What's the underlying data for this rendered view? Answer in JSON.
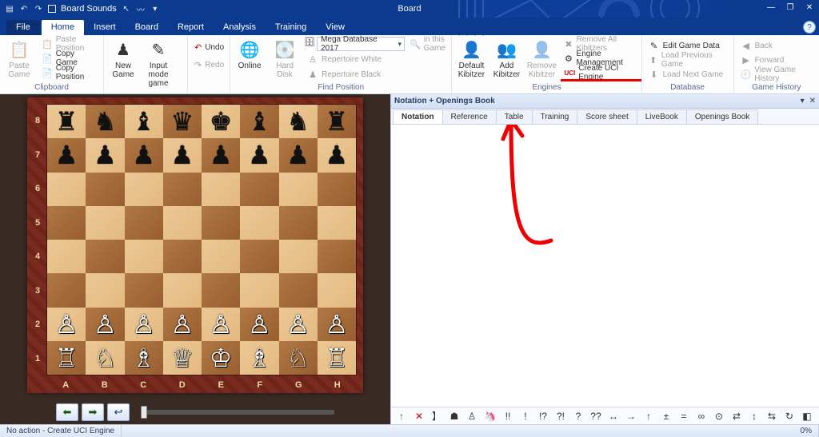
{
  "app": {
    "title": "Board",
    "sounds_label": "Board Sounds"
  },
  "window_buttons": {
    "minimize": "—",
    "maximize": "❐",
    "close": "✕"
  },
  "tabs": {
    "file": "File",
    "items": [
      "Home",
      "Insert",
      "Board",
      "Report",
      "Analysis",
      "Training",
      "View"
    ],
    "active_index": 0
  },
  "ribbon": {
    "clipboard": {
      "title": "Clipboard",
      "paste_game": "Paste\nGame",
      "paste_position": "Paste Position",
      "copy_game": "Copy Game",
      "copy_position": "Copy Position"
    },
    "gamemode": {
      "new_game": "New\nGame",
      "input_mode": "Input\nmode\ngame",
      "undo": "Undo",
      "redo": "Redo"
    },
    "find": {
      "title": "Find Position",
      "online": "Online",
      "hard_disk": "Hard\nDisk",
      "database_label": "Mega Database 2017",
      "in_this_game": "in this Game",
      "rep_white": "Repertoire White",
      "rep_black": "Repertoire Black"
    },
    "engines": {
      "title": "Engines",
      "default_kibitzer": "Default\nKibitzer",
      "add_kibitzer": "Add\nKibitzer",
      "remove_kibitzer": "Remove\nKibitzer",
      "remove_all": "Remove All Kibitzers",
      "engine_mgmt": "Engine Management",
      "create_uci": "Create UCI Engine"
    },
    "database": {
      "title": "Database",
      "edit_game": "Edit Game Data",
      "load_prev": "Load Previous Game",
      "load_next": "Load Next Game"
    },
    "history": {
      "title": "Game History",
      "back": "Back",
      "forward": "Forward",
      "view_history": "View Game History"
    }
  },
  "board": {
    "ranks": [
      "8",
      "7",
      "6",
      "5",
      "4",
      "3",
      "2",
      "1"
    ],
    "files": [
      "A",
      "B",
      "C",
      "D",
      "E",
      "F",
      "G",
      "H"
    ],
    "position_rows": [
      [
        {
          "p": "♜",
          "c": "b"
        },
        {
          "p": "♞",
          "c": "b"
        },
        {
          "p": "♝",
          "c": "b"
        },
        {
          "p": "♛",
          "c": "b"
        },
        {
          "p": "♚",
          "c": "b"
        },
        {
          "p": "♝",
          "c": "b"
        },
        {
          "p": "♞",
          "c": "b"
        },
        {
          "p": "♜",
          "c": "b"
        }
      ],
      [
        {
          "p": "♟",
          "c": "b"
        },
        {
          "p": "♟",
          "c": "b"
        },
        {
          "p": "♟",
          "c": "b"
        },
        {
          "p": "♟",
          "c": "b"
        },
        {
          "p": "♟",
          "c": "b"
        },
        {
          "p": "♟",
          "c": "b"
        },
        {
          "p": "♟",
          "c": "b"
        },
        {
          "p": "♟",
          "c": "b"
        }
      ],
      [
        null,
        null,
        null,
        null,
        null,
        null,
        null,
        null
      ],
      [
        null,
        null,
        null,
        null,
        null,
        null,
        null,
        null
      ],
      [
        null,
        null,
        null,
        null,
        null,
        null,
        null,
        null
      ],
      [
        null,
        null,
        null,
        null,
        null,
        null,
        null,
        null
      ],
      [
        {
          "p": "♙",
          "c": "w"
        },
        {
          "p": "♙",
          "c": "w"
        },
        {
          "p": "♙",
          "c": "w"
        },
        {
          "p": "♙",
          "c": "w"
        },
        {
          "p": "♙",
          "c": "w"
        },
        {
          "p": "♙",
          "c": "w"
        },
        {
          "p": "♙",
          "c": "w"
        },
        {
          "p": "♙",
          "c": "w"
        }
      ],
      [
        {
          "p": "♖",
          "c": "w"
        },
        {
          "p": "♘",
          "c": "w"
        },
        {
          "p": "♗",
          "c": "w"
        },
        {
          "p": "♕",
          "c": "w"
        },
        {
          "p": "♔",
          "c": "w"
        },
        {
          "p": "♗",
          "c": "w"
        },
        {
          "p": "♘",
          "c": "w"
        },
        {
          "p": "♖",
          "c": "w"
        }
      ]
    ]
  },
  "notation_panel": {
    "title": "Notation + Openings Book",
    "tabs": [
      "Notation",
      "Reference",
      "Table",
      "Training",
      "Score sheet",
      "LiveBook",
      "Openings Book"
    ],
    "active_index": 0
  },
  "symbols": [
    "↑",
    "✕",
    "】",
    "☗",
    "♙",
    "🦄",
    "!!",
    "!",
    "!?",
    "?!",
    "?",
    "??",
    "↔",
    "→",
    "↑",
    "±",
    "=",
    "∞",
    "⊙",
    "⇄",
    "↕",
    "⇆",
    "↻",
    "◧"
  ],
  "status": {
    "text": "No action - Create UCI Engine",
    "zoom": "0%"
  }
}
